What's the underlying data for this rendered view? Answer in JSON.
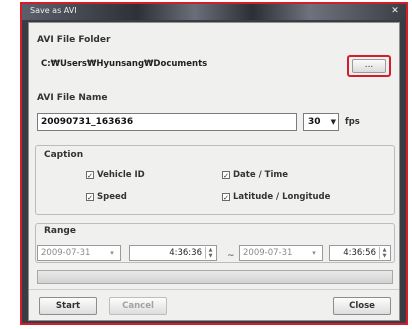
{
  "window": {
    "title": "Save as AVI",
    "close_glyph": "✕"
  },
  "folder": {
    "label": "AVI File Folder",
    "path": "C:₩Users₩Hyunsang₩Documents",
    "browse_label": "...",
    "highlight_color": "#d41c2a"
  },
  "file": {
    "label": "AVI File Name",
    "name": "20090731_163636",
    "fps_value": "30",
    "fps_unit": "fps"
  },
  "caption": {
    "label": "Caption",
    "options": [
      {
        "label": "Vehicle ID",
        "checked": true
      },
      {
        "label": "Date / Time",
        "checked": true
      },
      {
        "label": "Speed",
        "checked": true
      },
      {
        "label": "Latitude / Longitude",
        "checked": true
      }
    ]
  },
  "range": {
    "label": "Range",
    "start_date": "2009-07-31",
    "start_time": "4:36:36",
    "separator": "~",
    "end_date": "2009-07-31",
    "end_time": "4:36:56"
  },
  "progress": {
    "value": 0
  },
  "buttons": {
    "start": "Start",
    "cancel": "Cancel",
    "close": "Close"
  },
  "icons": {
    "checked": "checkmark-icon",
    "dropdown": "dropdown-arrow-icon",
    "calendar": "calendar-icon"
  }
}
